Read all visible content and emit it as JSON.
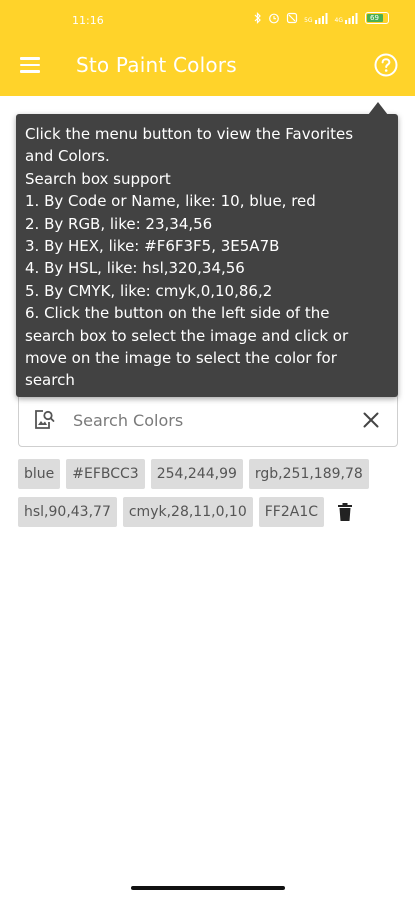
{
  "status_bar": {
    "time": "11:16",
    "battery": "69",
    "network_1": "5G",
    "network_2": "4G"
  },
  "app_bar": {
    "title": "Sto Paint Colors",
    "menu_icon": "hamburger-menu-icon",
    "help_icon": "help-circle-icon",
    "background_color": "#FFD32A"
  },
  "tooltip": {
    "lines": [
      "Click the menu button to view the Favorites",
      "and Colors.",
      "Search box support",
      "1. By Code or Name, like: 10, blue, red",
      "2. By RGB, like: 23,34,56",
      "3. By HEX, like: #F6F3F5, 3E5A7B",
      "4. By HSL, like: hsl,320,34,56",
      "5. By CMYK, like: cmyk,0,10,86,2",
      "6. Click the button on the left side of the",
      "search box to select the image and click or",
      "move on the image to select the color for",
      "search"
    ]
  },
  "search": {
    "placeholder": "Search Colors",
    "value": "",
    "image_icon": "image-search-icon",
    "clear_icon": "close-icon"
  },
  "history": {
    "chips": [
      "blue",
      "#EFBCC3",
      "254,244,99",
      "rgb,251,189,78",
      "hsl,90,43,77",
      "cmyk,28,11,0,10",
      "FF2A1C"
    ],
    "delete_icon": "trash-icon"
  }
}
